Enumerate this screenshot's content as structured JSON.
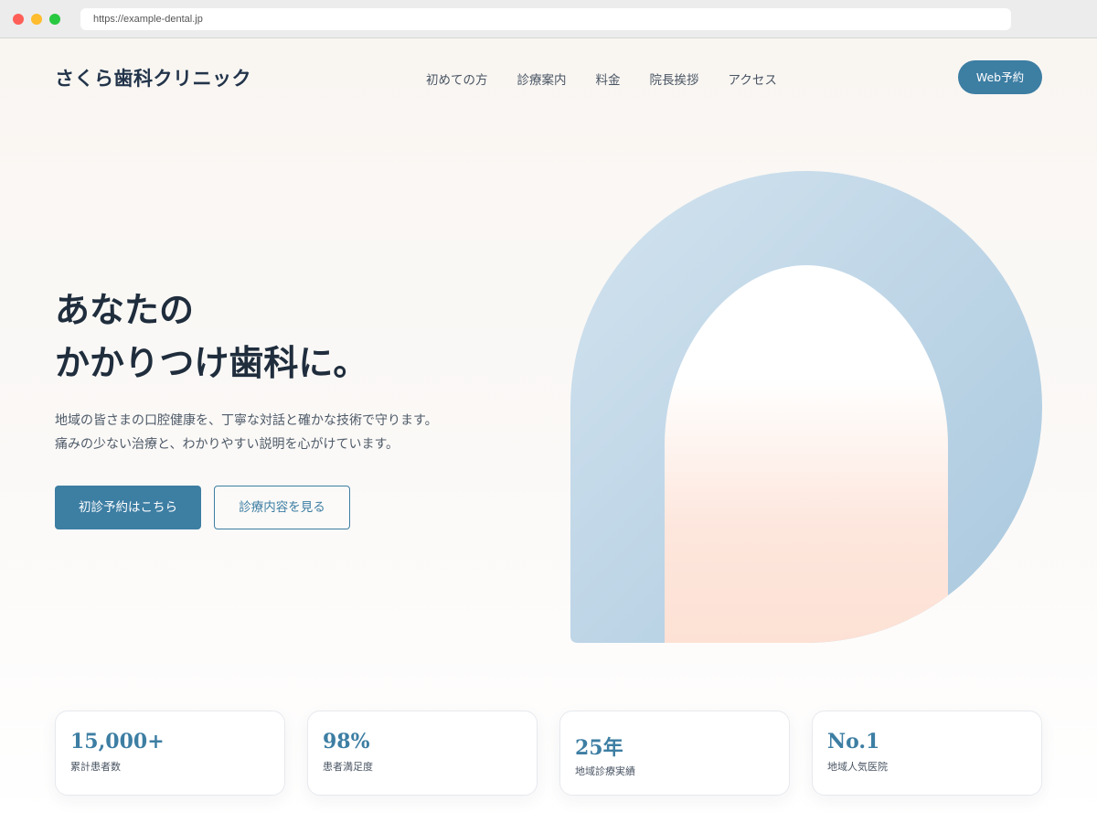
{
  "browser": {
    "url": "https://example-dental.jp"
  },
  "header": {
    "logo": "さくら歯科クリニック",
    "nav": [
      "初めての方",
      "診療案内",
      "料金",
      "院長挨拶",
      "アクセス"
    ],
    "cta_label": "Web予約"
  },
  "hero": {
    "title_line1": "あなたの",
    "title_line2": "かかりつけ歯科に。",
    "desc_line1": "地域の皆さまの口腔健康を、丁寧な対話と確かな技術で守ります。",
    "desc_line2": "痛みの少ない治療と、わかりやすい説明を心がけています。",
    "primary_button": "初診予約はこちら",
    "secondary_button": "診療内容を見る"
  },
  "stats": [
    {
      "value": "15,000+",
      "label": "累計患者数"
    },
    {
      "value": "98%",
      "label": "患者満足度"
    },
    {
      "value": "25年",
      "label": "地域診療実績"
    },
    {
      "value": "No.1",
      "label": "地域人気医院"
    }
  ],
  "colors": {
    "accent": "#3d7ea3",
    "arch_light": "#cfe0ee",
    "arch_dark": "#adcbe0",
    "inner_peach": "#fde3d8"
  }
}
